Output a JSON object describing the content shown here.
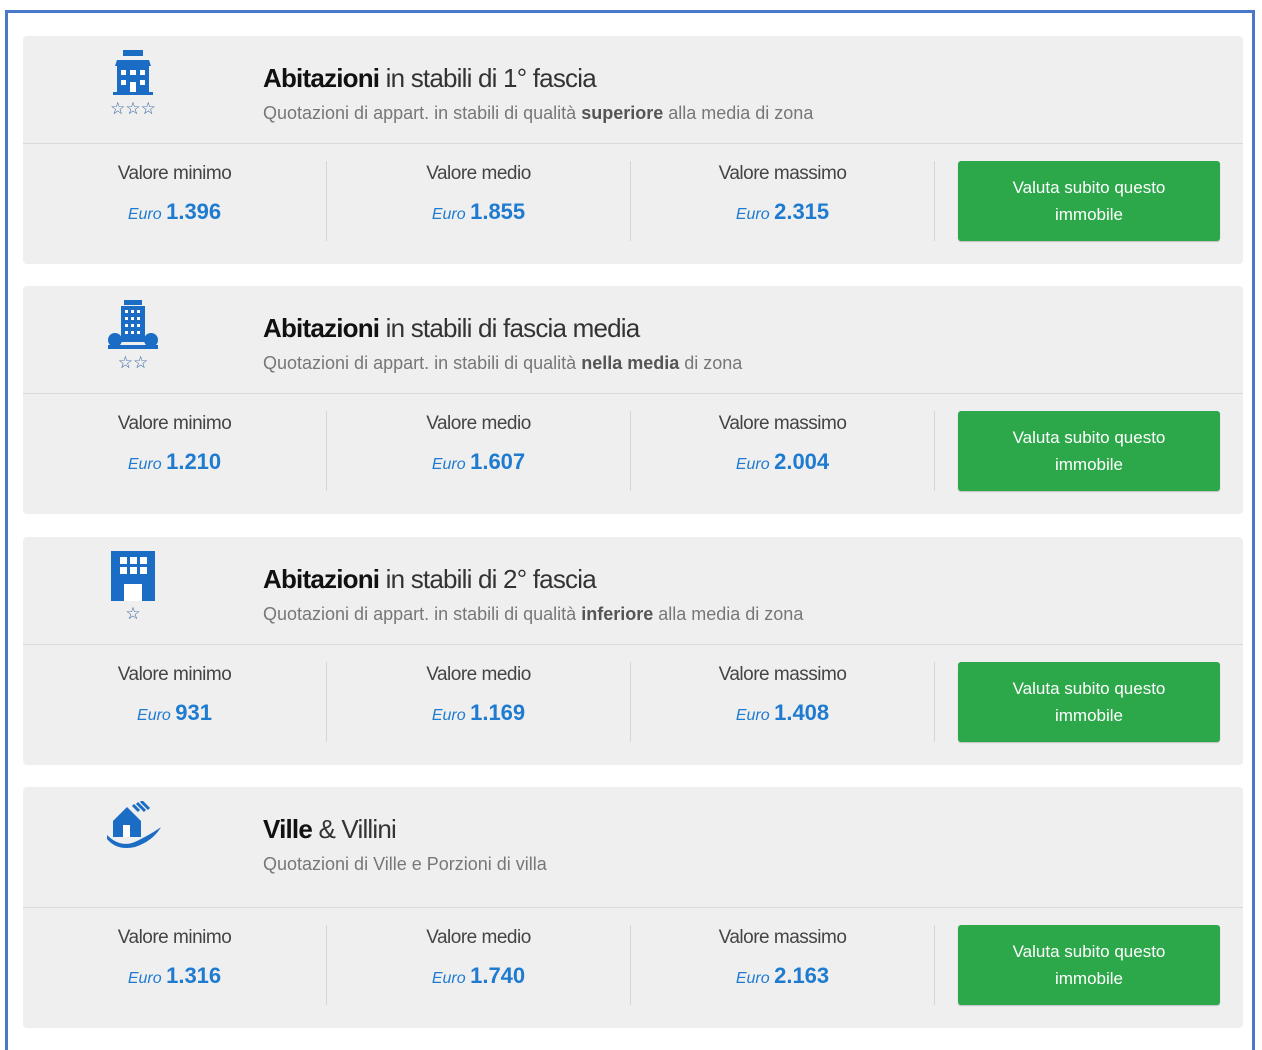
{
  "theme": {
    "accent": "#1e7bd0",
    "button": "#2ca84a",
    "frame": "#4a77c8",
    "icon": "#1a6cc4"
  },
  "cards": [
    {
      "icon": "house-villa-icon",
      "stars": "☆☆☆",
      "title_bold": "Abitazioni",
      "title_rest": " in stabili di 1° fascia",
      "sub_pre": "Quotazioni di appart. in stabili di qualità ",
      "sub_bold": "superiore",
      "sub_post": " alla media di zona",
      "values": [
        {
          "label": "Valore minimo",
          "currency": "Euro",
          "amount": "1.396"
        },
        {
          "label": "Valore medio",
          "currency": "Euro",
          "amount": "1.855"
        },
        {
          "label": "Valore massimo",
          "currency": "Euro",
          "amount": "2.315"
        }
      ],
      "button": "Valuta subito questo immobile"
    },
    {
      "icon": "tall-building-icon",
      "stars": "☆☆",
      "title_bold": "Abitazioni",
      "title_rest": " in stabili di fascia media",
      "sub_pre": "Quotazioni di appart. in stabili di qualità ",
      "sub_bold": "nella media",
      "sub_post": " di zona",
      "values": [
        {
          "label": "Valore minimo",
          "currency": "Euro",
          "amount": "1.210"
        },
        {
          "label": "Valore medio",
          "currency": "Euro",
          "amount": "1.607"
        },
        {
          "label": "Valore massimo",
          "currency": "Euro",
          "amount": "2.004"
        }
      ],
      "button": "Valuta subito questo immobile"
    },
    {
      "icon": "apartment-block-icon",
      "stars": "☆",
      "title_bold": "Abitazioni",
      "title_rest": " in stabili di 2° fascia",
      "sub_pre": "Quotazioni di appart. in stabili di qualità ",
      "sub_bold": "inferiore",
      "sub_post": " alla media di zona",
      "values": [
        {
          "label": "Valore minimo",
          "currency": "Euro",
          "amount": "931"
        },
        {
          "label": "Valore medio",
          "currency": "Euro",
          "amount": "1.169"
        },
        {
          "label": "Valore massimo",
          "currency": "Euro",
          "amount": "1.408"
        }
      ],
      "button": "Valuta subito questo immobile"
    },
    {
      "icon": "villa-hand-icon",
      "stars": "",
      "title_bold": "Ville",
      "title_rest": " & Villini",
      "sub_pre": "Quotazioni di Ville e Porzioni di villa",
      "sub_bold": "",
      "sub_post": "",
      "values": [
        {
          "label": "Valore minimo",
          "currency": "Euro",
          "amount": "1.316"
        },
        {
          "label": "Valore medio",
          "currency": "Euro",
          "amount": "1.740"
        },
        {
          "label": "Valore massimo",
          "currency": "Euro",
          "amount": "2.163"
        }
      ],
      "button": "Valuta subito questo immobile"
    }
  ]
}
